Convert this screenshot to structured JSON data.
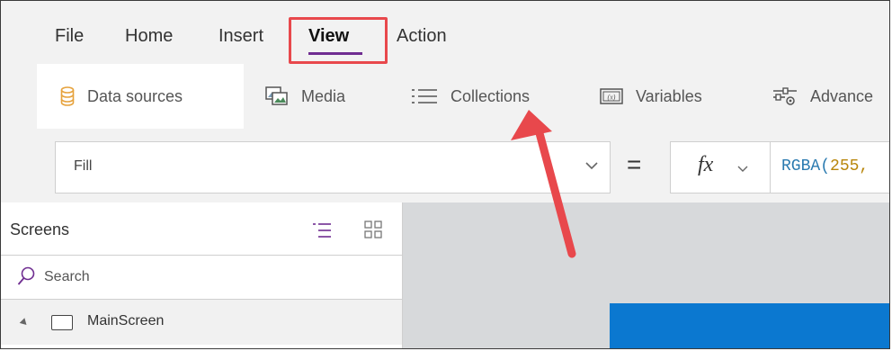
{
  "menu": {
    "tabs": [
      {
        "label": "File"
      },
      {
        "label": "Home"
      },
      {
        "label": "Insert"
      },
      {
        "label": "View"
      },
      {
        "label": "Action"
      }
    ],
    "active_tab": "View"
  },
  "ribbon": {
    "items": [
      {
        "label": "Data sources",
        "icon": "database-icon"
      },
      {
        "label": "Media",
        "icon": "media-icon"
      },
      {
        "label": "Collections",
        "icon": "collections-icon"
      },
      {
        "label": "Variables",
        "icon": "variables-icon"
      },
      {
        "label": "Advance",
        "icon": "advanced-settings-icon"
      }
    ]
  },
  "formula_bar": {
    "property": "Fill",
    "equals": "=",
    "fx": "fx",
    "formula_fn": "RGBA(",
    "formula_arg": "255,"
  },
  "screens_panel": {
    "title": "Screens",
    "search_placeholder": "Search",
    "items": [
      {
        "label": "MainScreen"
      }
    ]
  },
  "colors": {
    "accent": "#6f2d91",
    "highlight": "#e8484c",
    "preview_blue": "#0b78d0"
  }
}
